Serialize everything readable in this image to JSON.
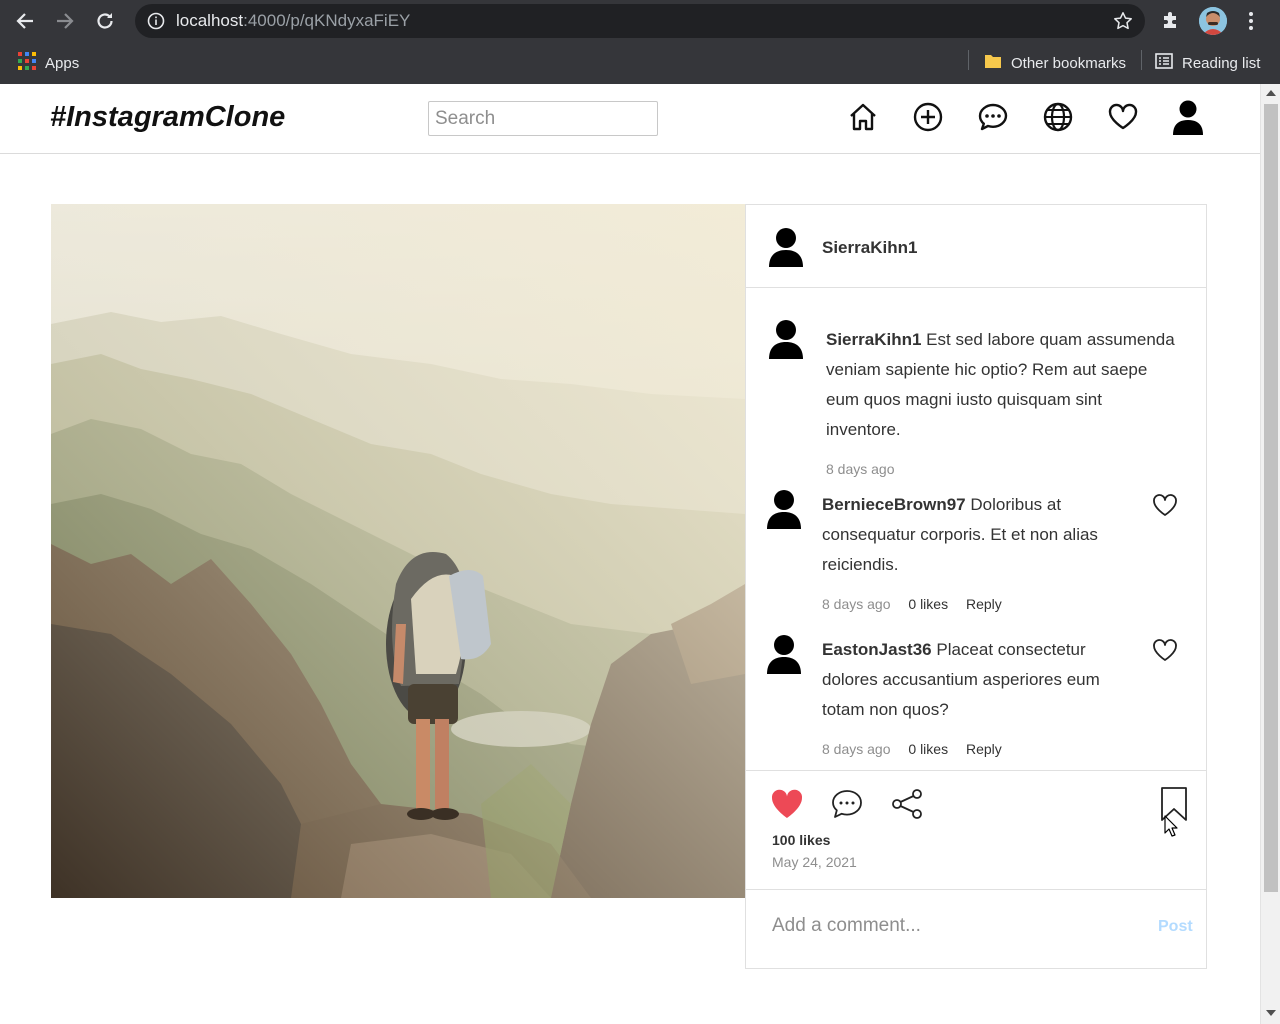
{
  "browser": {
    "url_host": "localhost",
    "url_path": ":4000/p/qKNdyxaFiEY",
    "bookmarks": {
      "apps": "Apps",
      "other": "Other bookmarks",
      "reading_list": "Reading list"
    }
  },
  "header": {
    "logo": "#InstagramClone",
    "search_placeholder": "Search",
    "nav_icons": [
      "home-icon",
      "add-post-icon",
      "messages-icon",
      "explore-icon",
      "activity-icon",
      "profile-icon"
    ]
  },
  "post": {
    "author": "SierraKihn1",
    "caption": {
      "username": "SierraKihn1",
      "text": "Est sed labore quam assumenda veniam sapiente hic optio? Rem aut saepe eum quos magni iusto quisquam sint inventore.",
      "time": "8 days ago"
    },
    "comments": [
      {
        "username": "BernieceBrown97",
        "text": "Doloribus at consequatur corporis. Et et non alias reiciendis.",
        "time": "8 days ago",
        "likes": "0 likes",
        "reply": "Reply"
      },
      {
        "username": "EastonJast36",
        "text": "Placeat consectetur dolores accusantium asperiores eum totam non quos?",
        "time": "8 days ago",
        "likes": "0 likes",
        "reply": "Reply"
      }
    ],
    "likes": "100 likes",
    "date": "May 24, 2021",
    "liked": true,
    "add_comment_placeholder": "Add a comment...",
    "post_label": "Post"
  },
  "colors": {
    "chrome_bg": "#35363a",
    "omnibox_bg": "#202124",
    "like_red": "#ed4956",
    "post_button": "#b3dbff",
    "border": "#dbdbdb"
  }
}
